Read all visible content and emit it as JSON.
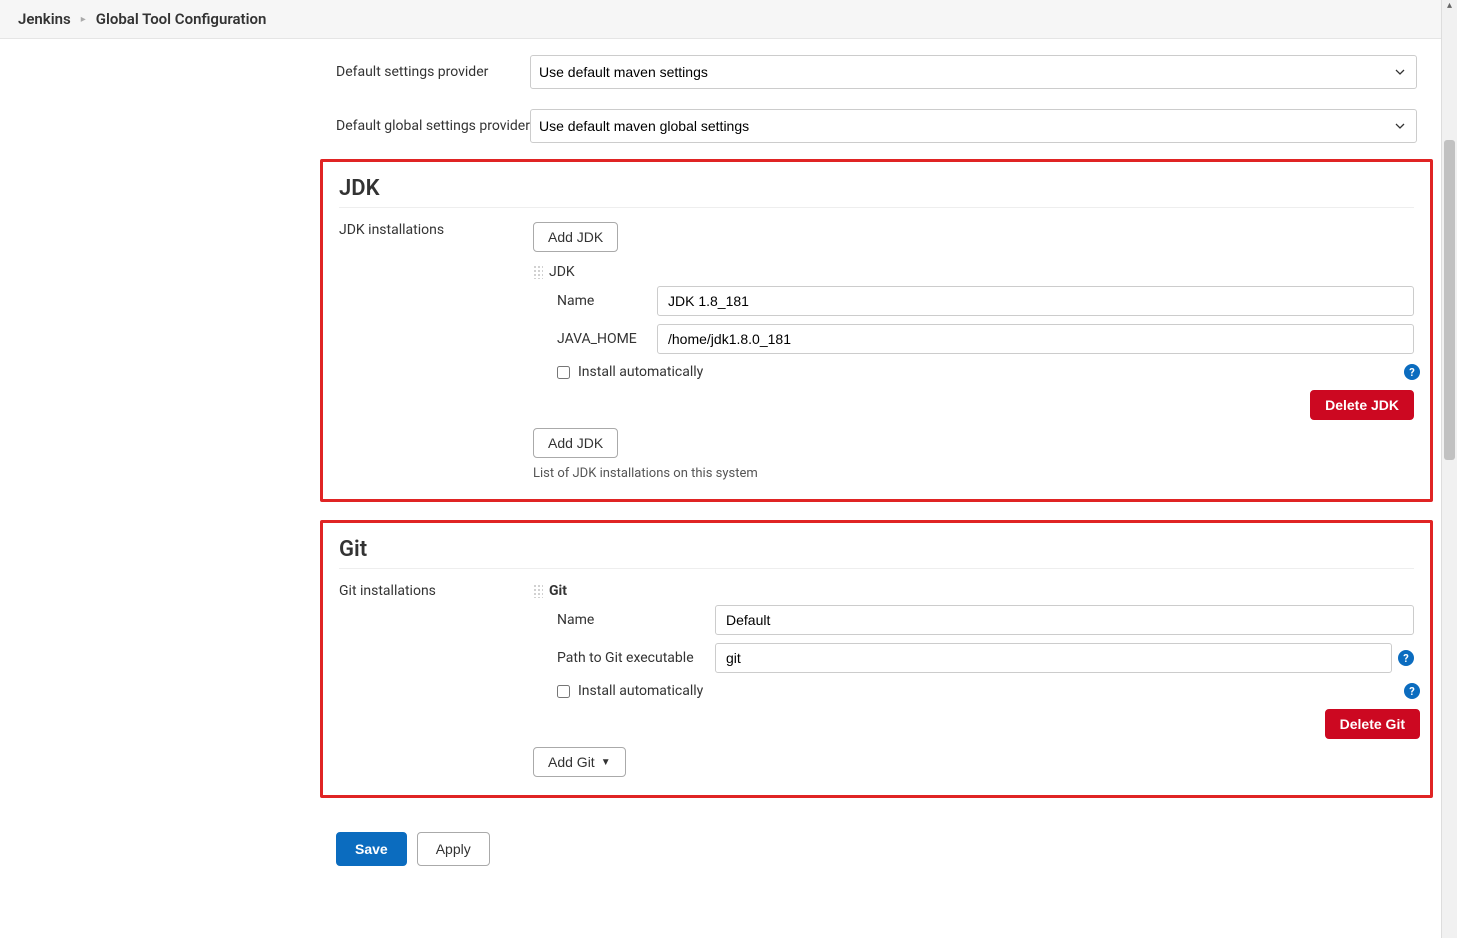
{
  "breadcrumb": {
    "root": "Jenkins",
    "page": "Global Tool Configuration"
  },
  "maven": {
    "default_settings_label": "Default settings provider",
    "default_settings_value": "Use default maven settings",
    "default_global_settings_label": "Default global settings provider",
    "default_global_settings_value": "Use default maven global settings"
  },
  "jdk": {
    "section_title": "JDK",
    "installations_label": "JDK installations",
    "add_button": "Add JDK",
    "tool_header": "JDK",
    "name_label": "Name",
    "name_value": "JDK 1.8_181",
    "home_label": "JAVA_HOME",
    "home_value": "/home/jdk1.8.0_181",
    "install_auto_label": "Install automatically",
    "delete_button": "Delete JDK",
    "add_button_bottom": "Add JDK",
    "help_text": "List of JDK installations on this system"
  },
  "git": {
    "section_title": "Git",
    "installations_label": "Git installations",
    "tool_header": "Git",
    "name_label": "Name",
    "name_value": "Default",
    "path_label": "Path to Git executable",
    "path_value": "git",
    "install_auto_label": "Install automatically",
    "delete_button": "Delete Git",
    "add_button": "Add Git"
  },
  "footer": {
    "save": "Save",
    "apply": "Apply"
  }
}
